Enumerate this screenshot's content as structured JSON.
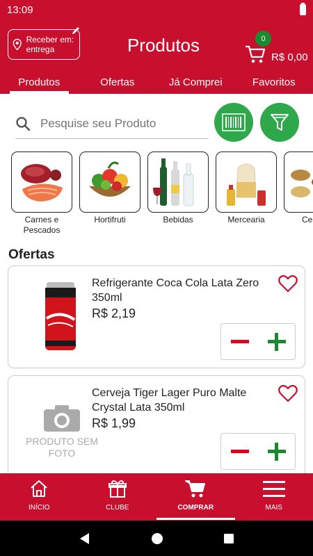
{
  "status_bar": {
    "time": "13:09"
  },
  "header": {
    "delivery_label": "Receber em: entrega",
    "title": "Produtos",
    "cart_count": "0",
    "cart_total": "R$ 0,00"
  },
  "tabs": [
    {
      "label": "Produtos",
      "active": true
    },
    {
      "label": "Ofertas",
      "active": false
    },
    {
      "label": "Já Comprei",
      "active": false
    },
    {
      "label": "Favoritos",
      "active": false
    }
  ],
  "search": {
    "placeholder": "Pesquise seu Produto"
  },
  "categories": [
    {
      "label": "Carnes e Pescados"
    },
    {
      "label": "Hortifruti"
    },
    {
      "label": "Bebidas"
    },
    {
      "label": "Mercearia"
    },
    {
      "label": "Cer Gr"
    }
  ],
  "offers_title": "Ofertas",
  "products": [
    {
      "name": "Refrigerante Coca Cola Lata Zero 350ml",
      "price": "R$ 2,19"
    },
    {
      "name": "Cerveja Tiger Lager Puro Malte Crystal Lata 350ml",
      "price": "R$ 1,99",
      "no_photo_label": "PRODUTO SEM FOTO"
    }
  ],
  "bottom_nav": [
    {
      "label": "INÍCIO",
      "icon": "home-icon",
      "active": false
    },
    {
      "label": "CLUBE",
      "icon": "gift-icon",
      "active": false
    },
    {
      "label": "COMPRAR",
      "icon": "cart-icon",
      "active": true
    },
    {
      "label": "MAIS",
      "icon": "menu-icon",
      "active": false
    }
  ],
  "colors": {
    "brand": "#c8102e",
    "accent_green": "#2ea84a",
    "minus_red": "#e0001b",
    "plus_green": "#1b8a2e"
  }
}
